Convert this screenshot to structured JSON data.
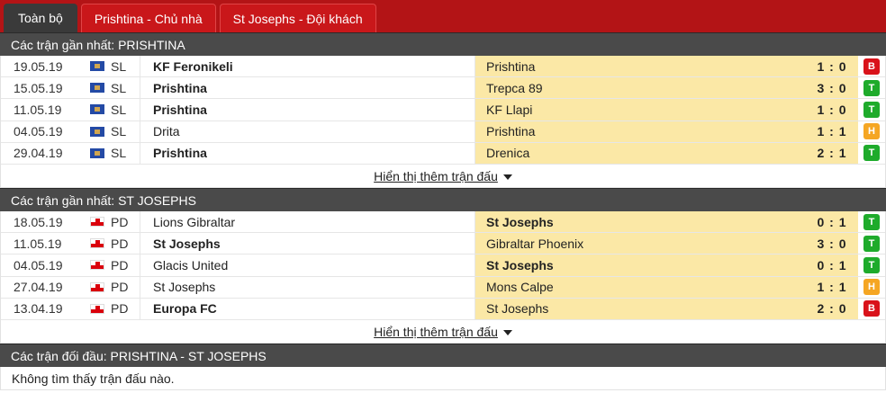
{
  "tabs": [
    {
      "label": "Toàn bộ"
    },
    {
      "label": "Prishtina - Chủ nhà"
    },
    {
      "label": "St Josephs - Đội khách"
    }
  ],
  "colors": {
    "win": "#1eab2b",
    "draw": "#f5a623",
    "loss": "#d9121a"
  },
  "sections": [
    {
      "title": "Các trận gần nhất: PRISHTINA",
      "flag": "kosovo-flag-icon",
      "rows": [
        {
          "date": "19.05.19",
          "league": "SL",
          "home": "KF Feronikeli",
          "away": "Prishtina",
          "score": "1 : 0",
          "result": "B"
        },
        {
          "date": "15.05.19",
          "league": "SL",
          "home": "Prishtina",
          "away": "Trepca 89",
          "score": "3 : 0",
          "result": "T"
        },
        {
          "date": "11.05.19",
          "league": "SL",
          "home": "Prishtina",
          "away": "KF Llapi",
          "score": "1 : 0",
          "result": "T"
        },
        {
          "date": "04.05.19",
          "league": "SL",
          "home": "Drita",
          "away": "Prishtina",
          "score": "1 : 1",
          "result": "H"
        },
        {
          "date": "29.04.19",
          "league": "SL",
          "home": "Prishtina",
          "away": "Drenica",
          "score": "2 : 1",
          "result": "T"
        }
      ],
      "more": "Hiển thị thêm trận đấu"
    },
    {
      "title": "Các trận gần nhất: ST JOSEPHS",
      "flag": "gibraltar-flag-icon",
      "rows": [
        {
          "date": "18.05.19",
          "league": "PD",
          "home": "Lions Gibraltar",
          "away": "St Josephs",
          "score": "0 : 1",
          "result": "T"
        },
        {
          "date": "11.05.19",
          "league": "PD",
          "home": "St Josephs",
          "away": "Gibraltar Phoenix",
          "score": "3 : 0",
          "result": "T"
        },
        {
          "date": "04.05.19",
          "league": "PD",
          "home": "Glacis United",
          "away": "St Josephs",
          "score": "0 : 1",
          "result": "T"
        },
        {
          "date": "27.04.19",
          "league": "PD",
          "home": "St Josephs",
          "away": "Mons Calpe",
          "score": "1 : 1",
          "result": "H"
        },
        {
          "date": "13.04.19",
          "league": "PD",
          "home": "Europa FC",
          "away": "St Josephs",
          "score": "2 : 0",
          "result": "B"
        }
      ],
      "more": "Hiển thị thêm trận đấu"
    }
  ],
  "h2h": {
    "title": "Các trận đối đầu: PRISHTINA - ST JOSEPHS",
    "empty": "Không tìm thấy trận đấu nào."
  }
}
